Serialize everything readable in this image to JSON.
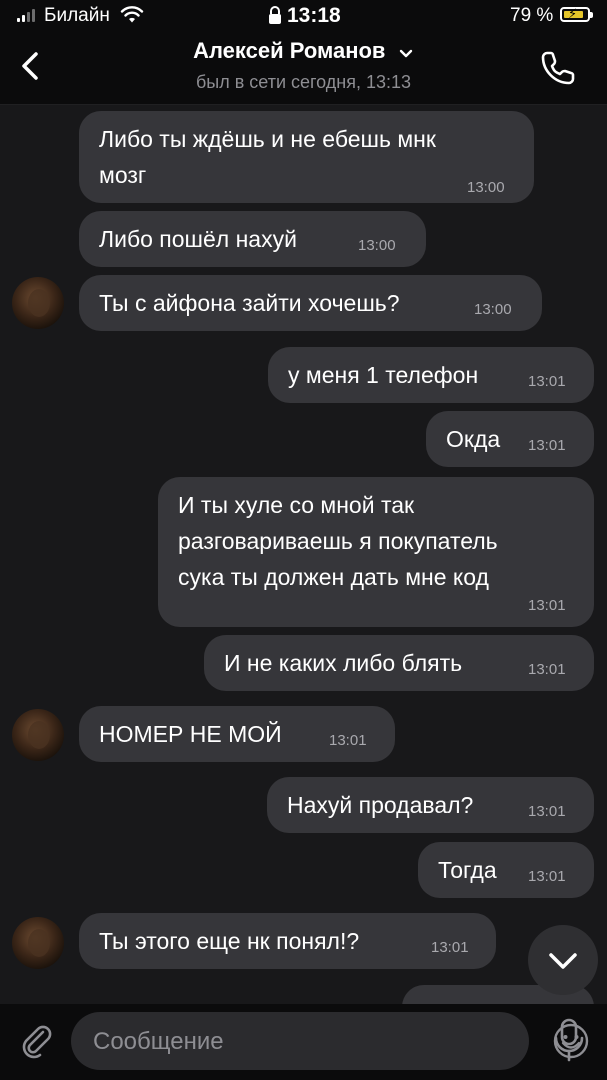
{
  "status_bar": {
    "carrier": "Билайн",
    "time": "13:18",
    "battery_percent": "79 %",
    "icons": [
      "signal-icon",
      "wifi-icon",
      "lock-icon",
      "battery-charging-icon"
    ]
  },
  "header": {
    "name": "Алексей Романов",
    "last_seen": "был в сети сегодня, 13:13",
    "icons": [
      "back-chevron-icon",
      "chevron-down-icon",
      "phone-icon"
    ]
  },
  "messages": [
    {
      "side": "incoming",
      "lines": [
        "Либо ты ждёшь и не ебешь мнк",
        "мозг"
      ],
      "time": "13:00",
      "avatar": false
    },
    {
      "side": "incoming",
      "lines": [
        "Либо пошёл нахуй"
      ],
      "time": "13:00",
      "avatar": false
    },
    {
      "side": "incoming",
      "lines": [
        "Ты с айфона зайти хочешь?"
      ],
      "time": "13:00",
      "avatar": true
    },
    {
      "side": "outgoing",
      "lines": [
        "у меня 1 телефон"
      ],
      "time": "13:01"
    },
    {
      "side": "outgoing",
      "lines": [
        "Окда"
      ],
      "time": "13:01"
    },
    {
      "side": "outgoing",
      "lines": [
        "И ты хуле со мной так",
        "разговариваешь я покупатель",
        "сука ты должен дать мне код"
      ],
      "time": "13:01"
    },
    {
      "side": "outgoing",
      "lines": [
        "И не каких либо блять"
      ],
      "time": "13:01"
    },
    {
      "side": "incoming",
      "lines": [
        "НОМЕР НЕ МОЙ"
      ],
      "time": "13:01",
      "avatar": true
    },
    {
      "side": "outgoing",
      "lines": [
        "Нахуй продавал?"
      ],
      "time": "13:01"
    },
    {
      "side": "outgoing",
      "lines": [
        "Тогда"
      ],
      "time": "13:01"
    },
    {
      "side": "incoming",
      "lines": [
        "Ты этого еще нк понял!?"
      ],
      "time": "13:01",
      "avatar": true
    }
  ],
  "input": {
    "placeholder": "Сообщение",
    "value": "",
    "icons": [
      "paperclip-icon",
      "emoji-icon",
      "microphone-icon"
    ]
  },
  "scroll_button": {
    "icon": "chevron-down-icon"
  },
  "colors": {
    "background": "#0b0b0c",
    "chat_background": "#18181a",
    "bubble": "#36363a",
    "secondary_text": "#8e8e93",
    "battery_fill": "#e5c52a"
  }
}
